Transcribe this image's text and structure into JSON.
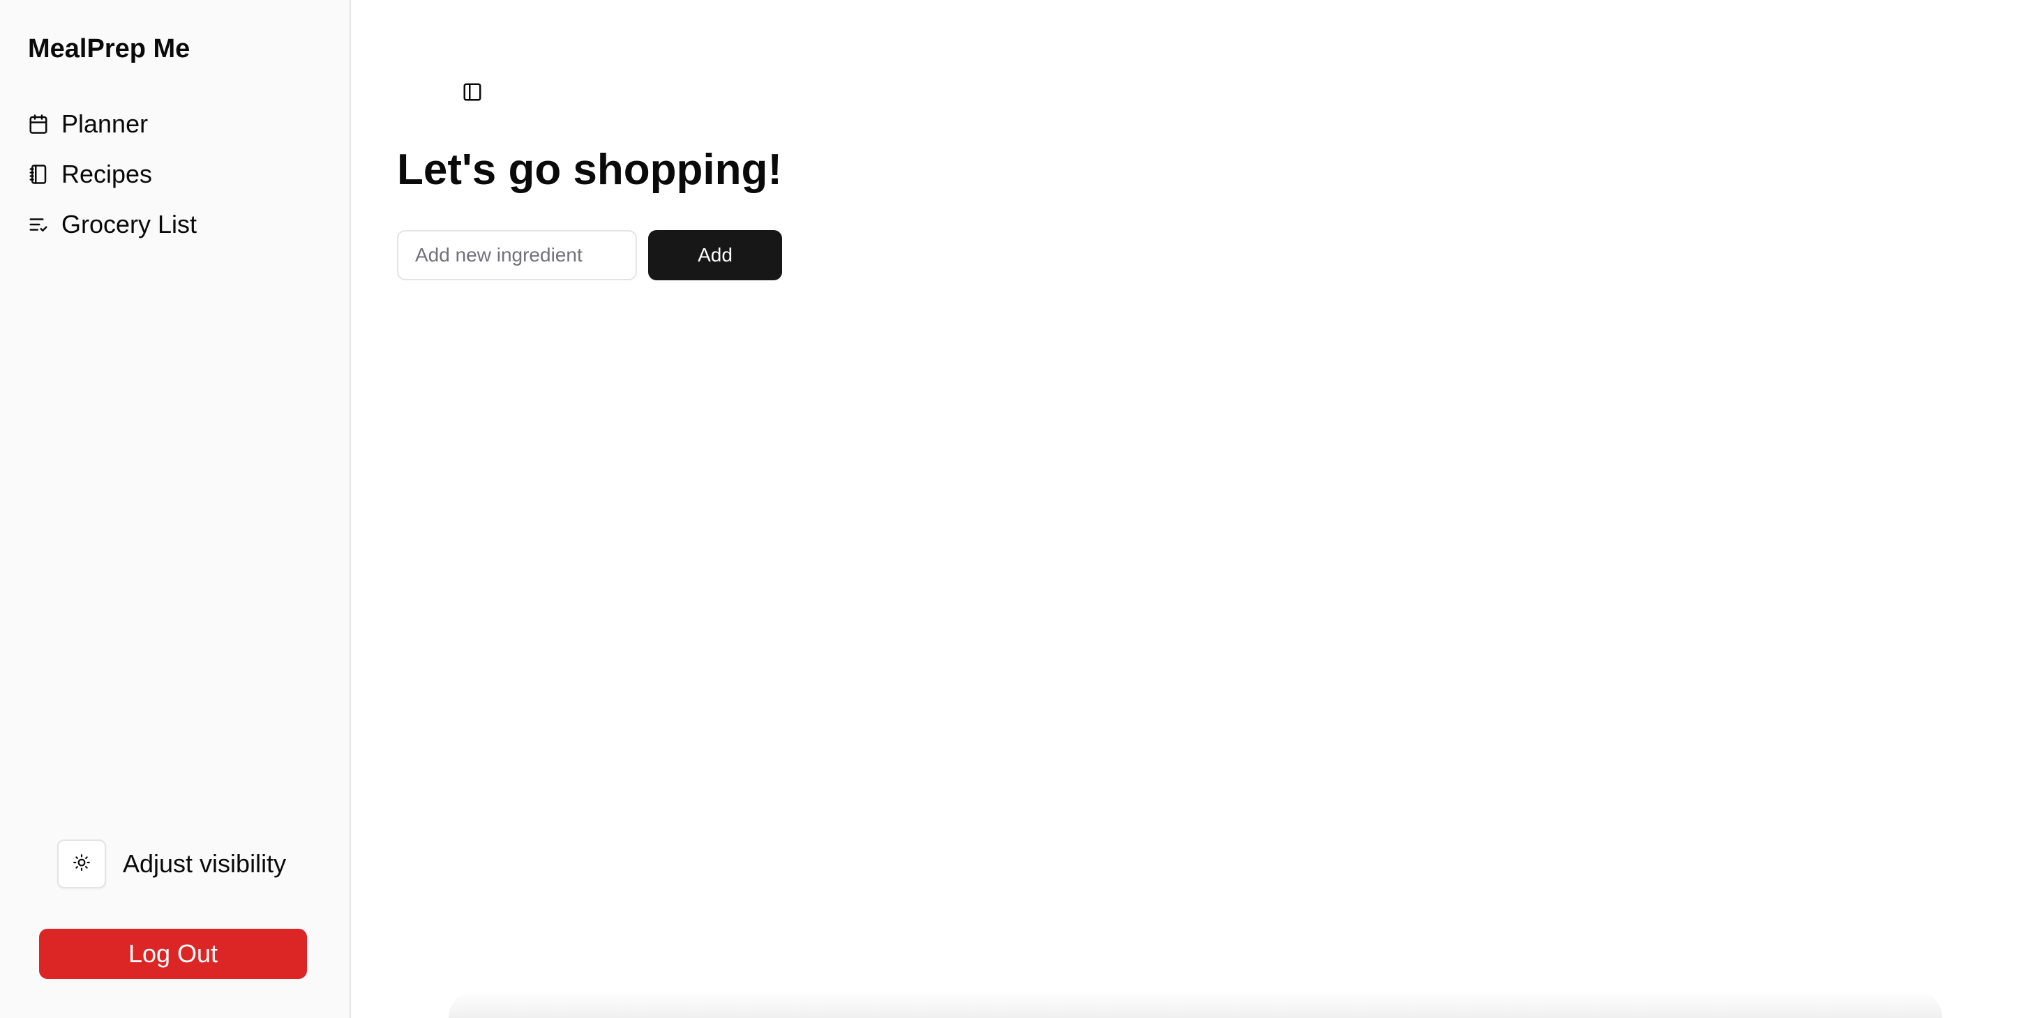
{
  "sidebar": {
    "brand": "MealPrep Me",
    "items": [
      {
        "label": "Planner",
        "icon": "calendar-icon"
      },
      {
        "label": "Recipes",
        "icon": "notebook-icon"
      },
      {
        "label": "Grocery List",
        "icon": "list-check-icon"
      }
    ],
    "visibility_label": "Adjust visibility",
    "visibility_icon": "sun-icon",
    "logout_label": "Log Out"
  },
  "main": {
    "toggle_icon": "panel-left-icon",
    "title": "Let's go shopping!",
    "ingredient_placeholder": "Add new ingredient",
    "add_label": "Add"
  },
  "colors": {
    "sidebar_bg": "#fafafa",
    "logout_bg": "#dc2626",
    "add_bg": "#171717",
    "border": "#e4e4e7"
  }
}
